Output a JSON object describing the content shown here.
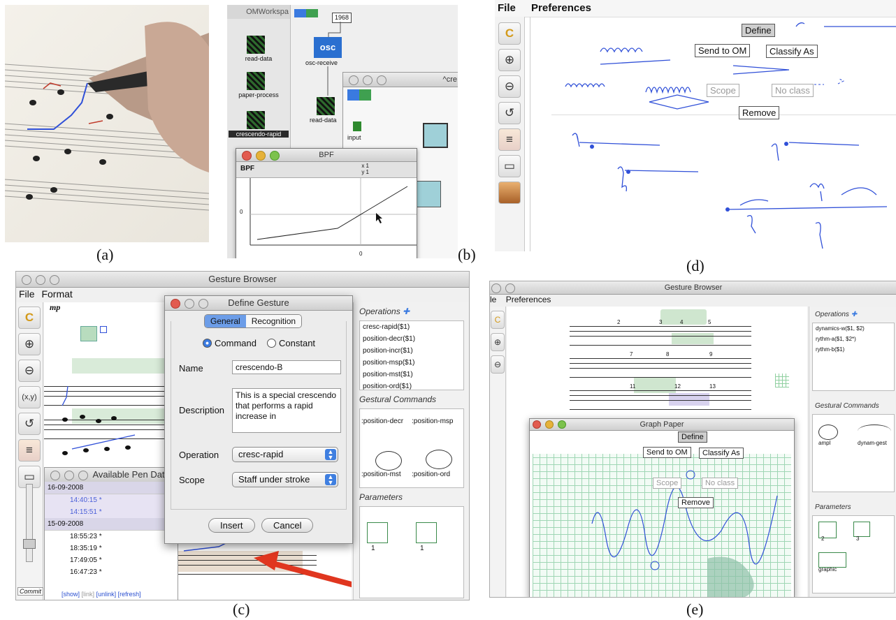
{
  "captions": {
    "a": "(a)",
    "b": "(b)",
    "c": "(c)",
    "d": "(d)",
    "e": "(e)"
  },
  "panel_b": {
    "workspace_title": "OMWorkspa",
    "icons": [
      "read-data",
      "paper-process",
      "crescendo-rapid"
    ],
    "number_box": "1968",
    "osc_label": "osc-receive",
    "read_data_label": "read-data",
    "input_label": "input",
    "window_title_partial": "^cre",
    "bpf_window_title": "BPF",
    "bpf_label": "BPF",
    "bpf_x": "x 1",
    "bpf_y": "y 1",
    "axis_zero_y": "0",
    "axis_zero_x": "0"
  },
  "panel_c": {
    "window_title": "Gesture Browser",
    "menu": [
      "File",
      "Format"
    ],
    "dynamic_mark": "mp",
    "xy_label": "(x,y)",
    "dialog": {
      "title": "Define Gesture",
      "tabs": [
        "General",
        "Recognition"
      ],
      "radio_command": "Command",
      "radio_constant": "Constant",
      "name_label": "Name",
      "name_value": "crescendo-B",
      "description_label": "Description",
      "description_value": "This is a special crescendo that performs a rapid increase in",
      "operation_label": "Operation",
      "operation_value": "cresc-rapid",
      "scope_label": "Scope",
      "scope_value": "Staff under stroke",
      "insert_button": "Insert",
      "cancel_button": "Cancel"
    },
    "pen_data": {
      "title": "Available Pen Dat",
      "rows": [
        {
          "text": "16-09-2008",
          "kind": "date"
        },
        {
          "text": "14:40:15 *",
          "kind": "sel"
        },
        {
          "text": "14:15:51 *",
          "kind": "sel"
        },
        {
          "text": "15-09-2008",
          "kind": "date"
        },
        {
          "text": "18:55:23 *",
          "kind": "time"
        },
        {
          "text": "18:35:19 *",
          "kind": "time"
        },
        {
          "text": "17:49:05 *",
          "kind": "time"
        },
        {
          "text": "16:47:23 *",
          "kind": "time"
        }
      ],
      "links": [
        "[show]",
        "[link]",
        "[unlink]",
        "[refresh]"
      ]
    },
    "commit_label": "Commit",
    "operations_header": "Operations",
    "operations": [
      "cresc-rapid($1)",
      "position-decr($1)",
      "position-incr($1)",
      "position-msp($1)",
      "position-mst($1)",
      "position-ord($1)"
    ],
    "gestural_header": "Gestural Commands",
    "gestural_items": [
      ":position-decr",
      ":position-msp",
      ":position-mst",
      ":position-ord"
    ],
    "parameters_header": "Parameters",
    "parameter_values": [
      "1",
      "1"
    ]
  },
  "panel_d": {
    "menu": [
      "File",
      "Preferences"
    ],
    "popup": {
      "define": "Define",
      "send_to_om": "Send to OM",
      "classify_as": "Classify As",
      "scope": "Scope",
      "no_class": "No class",
      "remove": "Remove"
    }
  },
  "panel_e": {
    "window_title": "Gesture Browser",
    "menu": [
      "le",
      "Preferences"
    ],
    "operations_header": "Operations",
    "operations": [
      "dynamics-w($1, $2)",
      "rythm-a($1, $2*)",
      "rythm-b($1)"
    ],
    "gestural_header": "Gestural Commands",
    "gestural_items": [
      "ampl",
      "dynam-gest"
    ],
    "parameters_header": "Parameters",
    "parameter_values": [
      "2",
      "3",
      "graphic"
    ],
    "measure_numbers": [
      "2",
      "3",
      "4",
      "5",
      "7",
      "8",
      "9",
      "11",
      "12",
      "13"
    ],
    "graph_paper": {
      "title": "Graph Paper",
      "define": "Define",
      "send_to_om": "Send to OM",
      "classify_as": "Classify As",
      "scope": "Scope",
      "no_class": "No class",
      "remove": "Remove"
    }
  },
  "colors": {
    "ink": "#3050d8",
    "highlight_green": "#cfe6cf",
    "highlight_purple": "#d8d2ee",
    "arrow_red": "#e0361f",
    "selection_blue": "#4a7fe8"
  }
}
